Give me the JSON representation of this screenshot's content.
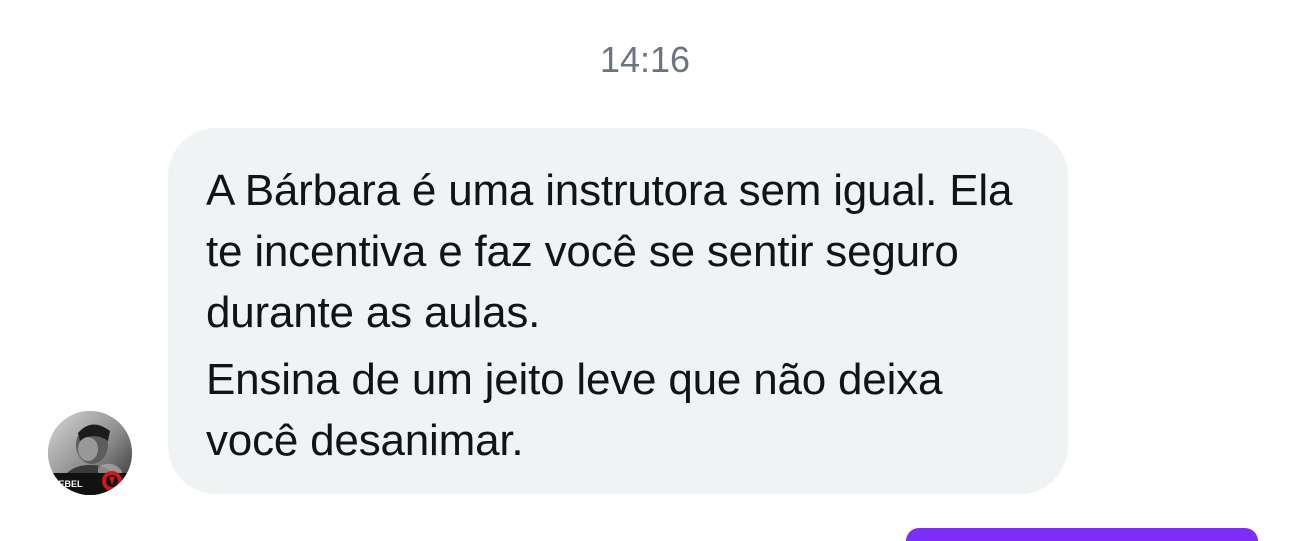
{
  "conversation": {
    "timestamp": "14:16",
    "incoming_message": {
      "paragraphs": [
        "A Bárbara é uma instrutora sem igual. Ela te incentiva e faz você se sentir seguro durante as aulas.",
        "Ensina de um jeito leve que não deixa você desanimar."
      ]
    },
    "sender_avatar": {
      "badge_text": "REBEL"
    },
    "colors": {
      "incoming_bubble": "#eff3f4",
      "outgoing_bubble": "#7b2ff7",
      "timestamp_text": "#6b7480",
      "message_text": "#0f1419"
    }
  }
}
